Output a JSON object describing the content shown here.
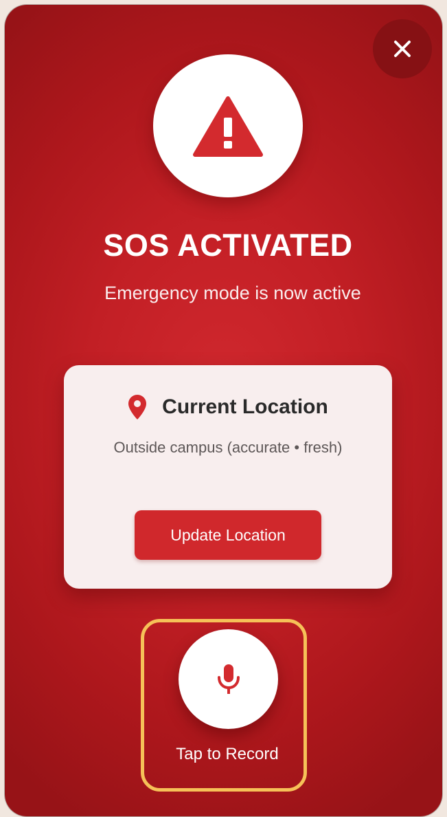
{
  "header": {
    "close_icon": "close-icon"
  },
  "alert": {
    "icon": "warning-triangle-icon",
    "title": "SOS ACTIVATED",
    "subtitle": "Emergency mode is now active"
  },
  "location_card": {
    "icon": "location-pin-icon",
    "title": "Current Location",
    "status_text": "Outside campus (accurate • fresh)",
    "update_label": "Update Location"
  },
  "recorder": {
    "icon": "microphone-icon",
    "label": "Tap to Record"
  },
  "colors": {
    "primary_red": "#c62228",
    "dark_red": "#861114",
    "card_bg": "#f8eeee",
    "highlight": "#f6c158",
    "white": "#ffffff"
  }
}
